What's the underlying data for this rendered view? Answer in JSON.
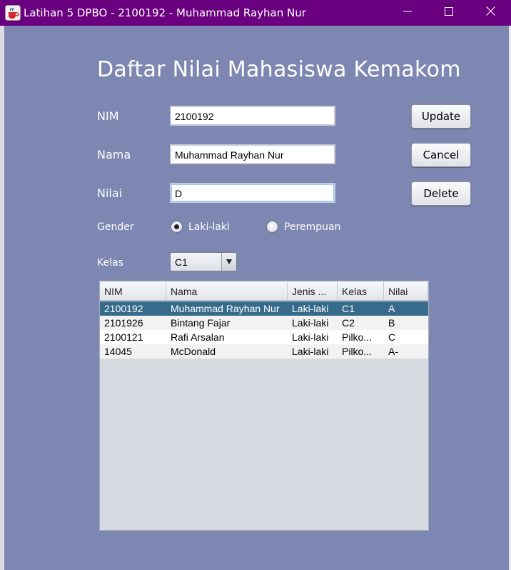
{
  "window": {
    "title": "Latihan 5 DPBO - 2100192 - Muhammad Rayhan Nur",
    "app_icon": "java-cup-icon",
    "controls": [
      "minimize-icon",
      "maximize-icon",
      "close-icon"
    ],
    "titlebar_color": "#6a007f"
  },
  "form": {
    "heading": "Daftar Nilai Mahasiswa Kemakom",
    "nim_label": "NIM",
    "nim_value": "2100192",
    "nama_label": "Nama",
    "nama_value": "Muhammad Rayhan Nur",
    "nilai_label": "Nilai",
    "nilai_value": "D",
    "gender_label": "Gender",
    "gender_options": [
      "Laki-laki",
      "Perempuan"
    ],
    "gender_selected": "Laki-laki",
    "kelas_label": "Kelas",
    "kelas_selected": "C1"
  },
  "buttons": {
    "update": "Update",
    "cancel": "Cancel",
    "delete": "Delete"
  },
  "table": {
    "columns": [
      "NIM",
      "Nama",
      "Jenis ...",
      "Kelas",
      "Nilai"
    ],
    "rows": [
      [
        "2100192",
        "Muhammad Rayhan Nur",
        "Laki-laki",
        "C1",
        "A"
      ],
      [
        "2101926",
        "Bintang Fajar",
        "Laki-laki",
        "C2",
        "B"
      ],
      [
        "2100121",
        "Rafi Arsalan",
        "Laki-laki",
        "Pilko...",
        "C"
      ],
      [
        "14045",
        "McDonald",
        "Laki-laki",
        "Pilko...",
        "A-"
      ]
    ],
    "selected_row_index": 0,
    "selection_color": "#376b8c"
  },
  "colors": {
    "background": "#7d87b1"
  }
}
